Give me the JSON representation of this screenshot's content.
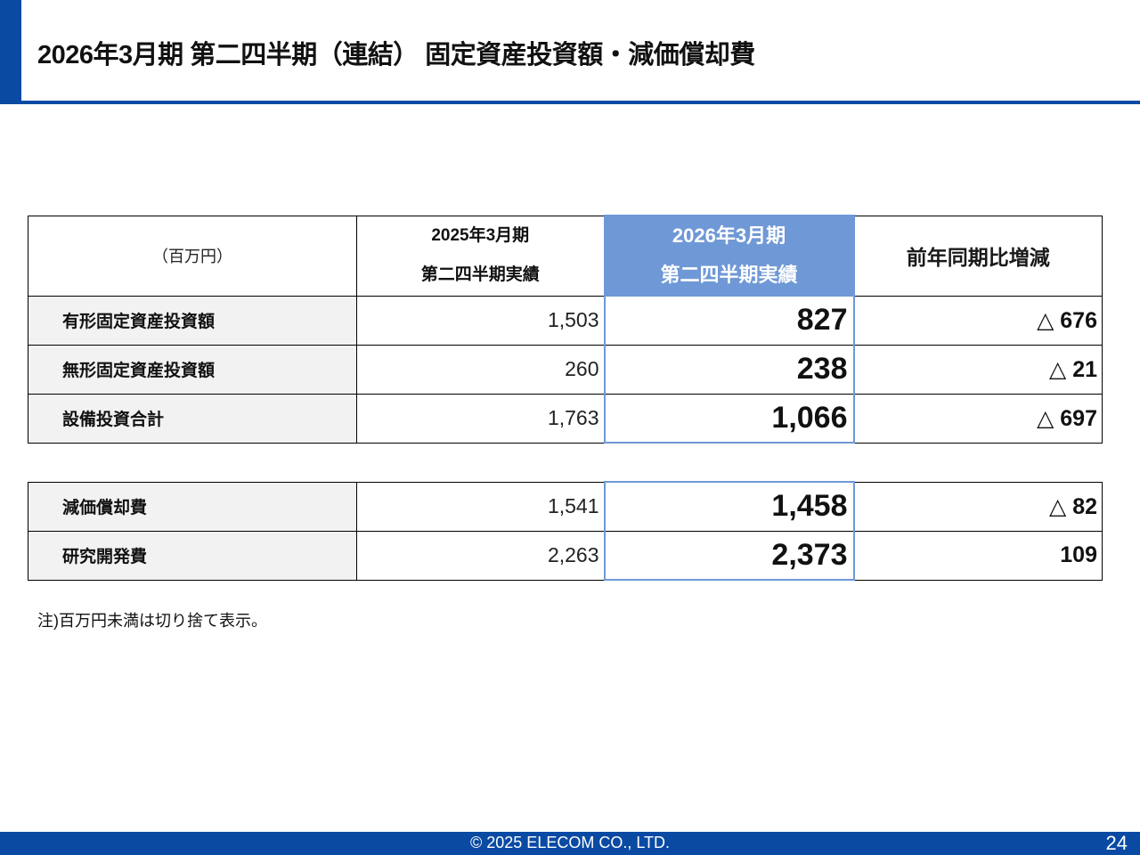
{
  "slide": {
    "title": "2026年3月期 第二四半期（連結） 固定資産投資額・減価償却費",
    "colors": {
      "accent": "#0a4aa3",
      "highlight": "#6f98d6",
      "label_bg": "#f2f2f2"
    }
  },
  "table_investment": {
    "unit_label": "（百万円）",
    "headers": [
      {
        "line1": "2025年3月期",
        "line2": "第二四半期実績"
      },
      {
        "line1": "2026年3月期",
        "line2": "第二四半期実績"
      },
      {
        "line1": "前年同期比増減"
      }
    ],
    "rows": [
      {
        "label": "有形固定資産投資額",
        "prev": "1,503",
        "current": "827",
        "diff": "△ 676"
      },
      {
        "label": "無形固定資産投資額",
        "prev": "260",
        "current": "238",
        "diff": "△ 21"
      },
      {
        "label": "設備投資合計",
        "prev": "1,763",
        "current": "1,066",
        "diff": "△ 697"
      }
    ]
  },
  "table_depreciation": {
    "rows": [
      {
        "label": "減価償却費",
        "prev": "1,541",
        "current": "1,458",
        "diff": "△ 82"
      },
      {
        "label": "研究開発費",
        "prev": "2,263",
        "current": "2,373",
        "diff": "109"
      }
    ]
  },
  "note": "注)百万円未満は切り捨て表示。",
  "footer": {
    "copyright": "© 2025 ELECOM CO., LTD.",
    "page_number": "24"
  }
}
